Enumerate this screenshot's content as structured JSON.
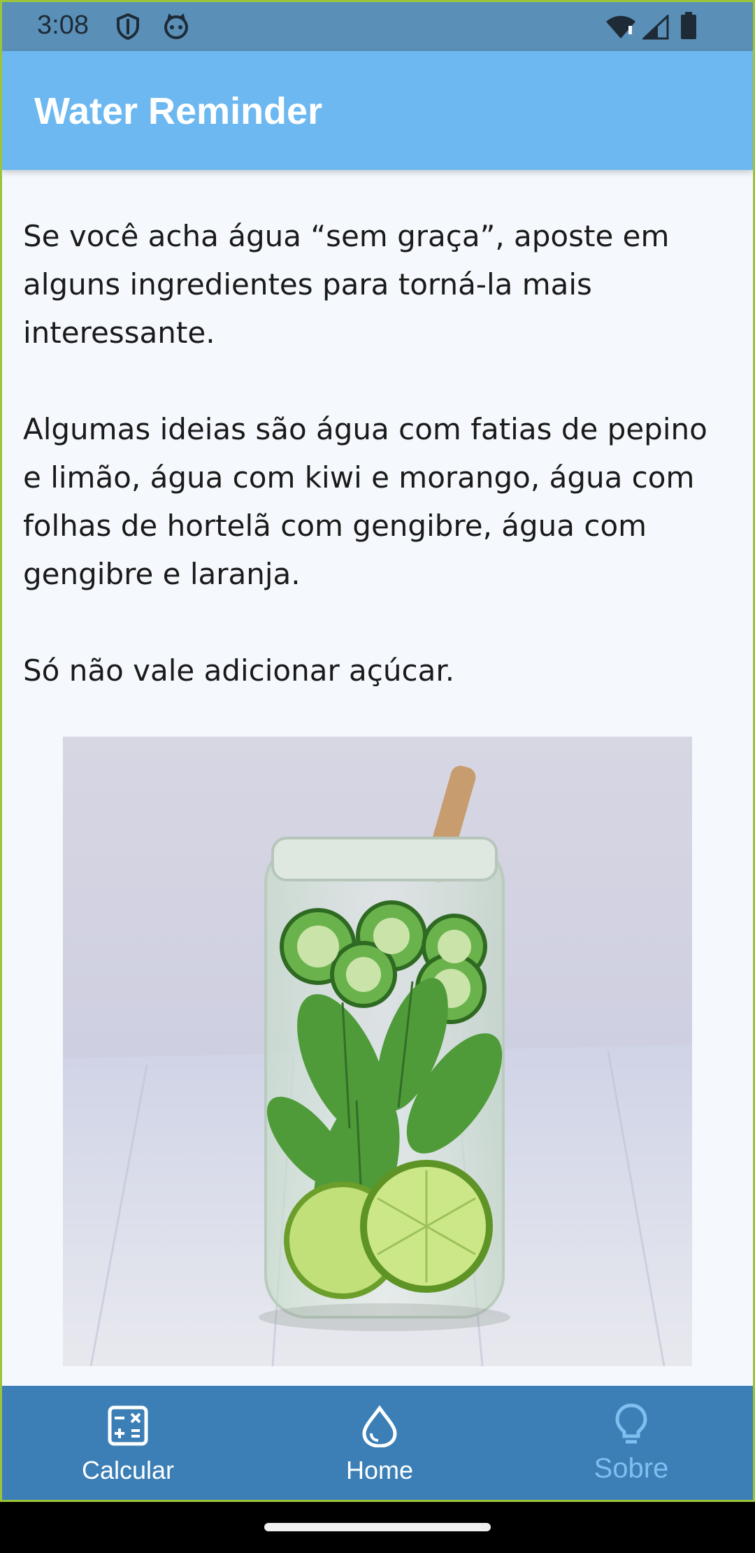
{
  "status_bar": {
    "time": "3:08"
  },
  "app_bar": {
    "title": "Water Reminder"
  },
  "content": {
    "paragraphs": [
      "Se você acha água “sem graça”, aposte em alguns ingredientes para torná-la mais interessante.",
      "Algumas ideias são água com fatias de pepino e limão, água com kiwi e morango, água com folhas de hortelã com gengibre, água com gengibre e laranja.",
      "Só não vale adicionar açúcar."
    ],
    "image_icon": "infused-water-jar-photo"
  },
  "bottom_nav": {
    "items": [
      {
        "label": "Calcular",
        "icon": "calculator-icon"
      },
      {
        "label": "Home",
        "icon": "water-drop-icon"
      },
      {
        "label": "Sobre",
        "icon": "lightbulb-icon"
      }
    ],
    "active_index": 1
  },
  "colors": {
    "status_bar": "#5a8fb8",
    "app_bar": "#6db8f0",
    "bottom_nav": "#3b7fb6",
    "inactive_nav": "#7fbff0",
    "background": "#f5f9fd"
  }
}
